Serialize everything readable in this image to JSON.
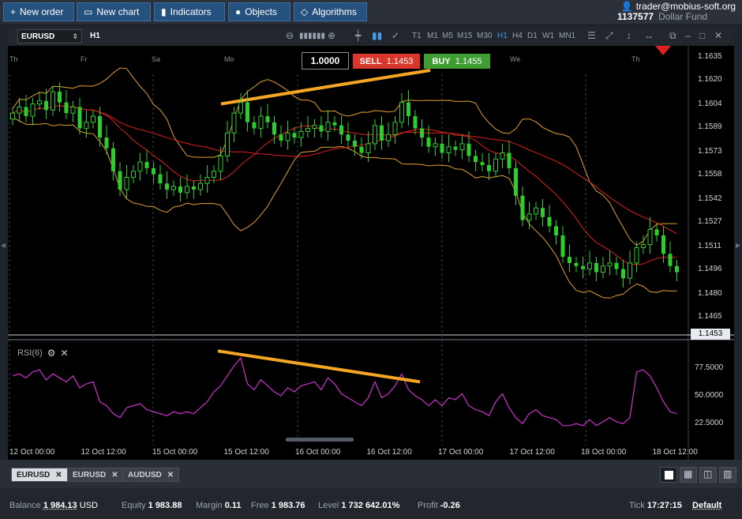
{
  "toolbar": {
    "buttons": [
      {
        "label": "New order",
        "icon": "plus-icon"
      },
      {
        "label": "New chart",
        "icon": "chart-icon"
      },
      {
        "label": "Indicators",
        "icon": "indicators-icon"
      },
      {
        "label": "Objects",
        "icon": "objects-icon"
      },
      {
        "label": "Algorithms",
        "icon": "algorithms-icon"
      }
    ]
  },
  "account": {
    "user": "trader@mobius-soft.org",
    "number": "1137577",
    "name": "Dollar Fund"
  },
  "chart": {
    "symbol": "EURUSD",
    "timeframe": "H1",
    "timeframes": [
      "T1",
      "M1",
      "M5",
      "M15",
      "M30",
      "H1",
      "H4",
      "D1",
      "W1",
      "MN1"
    ],
    "active_timeframe": "H1",
    "quantity": "1.0000",
    "sell_label": "SELL",
    "sell_price": "1.1453",
    "buy_label": "BUY",
    "buy_price": "1.1455",
    "current_price": "1.1453",
    "day_labels": [
      "Th",
      "Fr",
      "Sa",
      "Mo",
      "We",
      "Th"
    ],
    "price_ticks": [
      "1.1635",
      "1.1620",
      "1.1604",
      "1.1589",
      "1.1573",
      "1.1558",
      "1.1542",
      "1.1527",
      "1.1511",
      "1.1496",
      "1.1480",
      "1.1465"
    ],
    "rsi_label": "RSI(6)",
    "rsi_ticks": [
      "77.5000",
      "50.0000",
      "22.5000"
    ],
    "time_ticks": [
      "12 Oct 00:00",
      "12 Oct 12:00",
      "15 Oct 00:00",
      "15 Oct 12:00",
      "16 Oct 00:00",
      "16 Oct 12:00",
      "17 Oct 00:00",
      "17 Oct 12:00",
      "18 Oct 00:00",
      "18 Oct 12:00"
    ],
    "colors": {
      "bull": "#2ecc2e",
      "bear": "#2ecc2e",
      "bands": "#e0a030",
      "ma": "#e02020",
      "rsi": "#cc33cc",
      "trendline": "#f5a623"
    }
  },
  "chart_data": {
    "type": "candlestick",
    "symbol": "EURUSD",
    "timeframe": "H1",
    "price_range": [
      1.1455,
      1.1642
    ],
    "close_series": [
      1.1598,
      1.1602,
      1.1596,
      1.1604,
      1.1606,
      1.16,
      1.1612,
      1.1605,
      1.1598,
      1.1602,
      1.1588,
      1.1592,
      1.1596,
      1.1582,
      1.1575,
      1.156,
      1.1548,
      1.1556,
      1.156,
      1.1566,
      1.1562,
      1.1558,
      1.1552,
      1.1548,
      1.155,
      1.1546,
      1.155,
      1.1548,
      1.1552,
      1.1556,
      1.156,
      1.157,
      1.1585,
      1.1598,
      1.1605,
      1.1592,
      1.1588,
      1.1596,
      1.1592,
      1.1584,
      1.158,
      1.1585,
      1.1582,
      1.1586,
      1.1588,
      1.159,
      1.1586,
      1.1592,
      1.159,
      1.1584,
      1.158,
      1.1576,
      1.1572,
      1.1578,
      1.159,
      1.158,
      1.1584,
      1.1592,
      1.1605,
      1.1596,
      1.1588,
      1.1582,
      1.1576,
      1.1578,
      1.1572,
      1.1576,
      1.1574,
      1.1578,
      1.157,
      1.1566,
      1.1564,
      1.156,
      1.1568,
      1.1572,
      1.1562,
      1.1544,
      1.1528,
      1.1532,
      1.1536,
      1.153,
      1.1524,
      1.1518,
      1.1504,
      1.15,
      1.1498,
      1.1496,
      1.15,
      1.1494,
      1.1498,
      1.15,
      1.1496,
      1.149,
      1.15,
      1.151,
      1.1512,
      1.1522,
      1.1518,
      1.1506,
      1.1498,
      1.1494
    ],
    "rsi_series": [
      70,
      72,
      68,
      74,
      76,
      66,
      72,
      68,
      64,
      70,
      58,
      62,
      64,
      44,
      40,
      32,
      28,
      38,
      40,
      42,
      36,
      34,
      32,
      30,
      34,
      32,
      34,
      32,
      38,
      44,
      54,
      60,
      70,
      80,
      88,
      62,
      56,
      66,
      60,
      54,
      50,
      58,
      54,
      60,
      62,
      64,
      56,
      68,
      62,
      52,
      48,
      44,
      40,
      48,
      64,
      48,
      52,
      60,
      72,
      56,
      50,
      46,
      40,
      46,
      40,
      48,
      46,
      52,
      40,
      36,
      34,
      30,
      44,
      52,
      38,
      28,
      22,
      32,
      36,
      30,
      28,
      26,
      20,
      20,
      22,
      20,
      26,
      20,
      24,
      28,
      24,
      22,
      28,
      74,
      76,
      70,
      58,
      44,
      34,
      32
    ],
    "rsi_ticks": [
      77.5,
      50.0,
      22.5
    ],
    "rsi_range": [
      0,
      100
    ]
  },
  "tabs": [
    "EURUSD",
    "EURUSD",
    "AUDUSD"
  ],
  "status": {
    "balance_label": "Balance",
    "balance": "1 984.13",
    "currency": "USD",
    "equity_label": "Equity",
    "equity": "1 983.88",
    "margin_label": "Margin",
    "margin": "0.11",
    "free_label": "Free",
    "free": "1 983.76",
    "level_label": "Level",
    "level": "1 732 642.01%",
    "profit_label": "Profit",
    "profit": "-0.26",
    "tick_label": "Tick",
    "tick": "17:27:15",
    "default_label": "Default"
  }
}
